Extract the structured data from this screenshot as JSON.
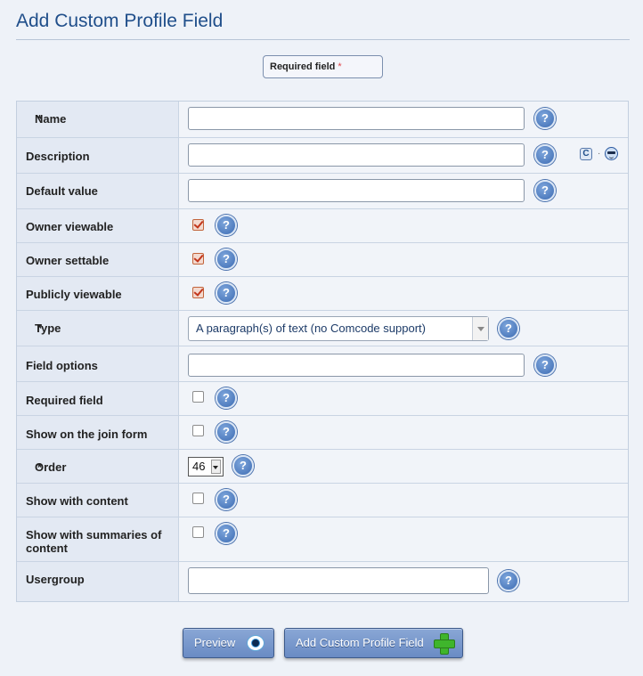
{
  "page": {
    "title": "Add Custom Profile Field"
  },
  "legend": {
    "label": "Required field",
    "star": "*"
  },
  "fields": {
    "name": {
      "label": "Name",
      "star": "*",
      "value": ""
    },
    "description": {
      "label": "Description",
      "value": ""
    },
    "default_value": {
      "label": "Default value",
      "value": ""
    },
    "owner_viewable": {
      "label": "Owner viewable",
      "checked": true
    },
    "owner_settable": {
      "label": "Owner settable",
      "checked": true
    },
    "publicly_viewable": {
      "label": "Publicly viewable",
      "checked": true
    },
    "type": {
      "label": "Type",
      "star": "*",
      "selected": "A paragraph(s) of text (no Comcode support)"
    },
    "field_options": {
      "label": "Field options",
      "value": ""
    },
    "required_field": {
      "label": "Required field",
      "checked": false
    },
    "show_on_join_form": {
      "label": "Show on the join form",
      "checked": false
    },
    "order": {
      "label": "Order",
      "star": "*",
      "selected": "46"
    },
    "show_with_content": {
      "label": "Show with content",
      "checked": false
    },
    "show_with_summaries": {
      "label_line1": "Show with summaries of",
      "label_line2": "content",
      "checked": false
    },
    "usergroup": {
      "label": "Usergroup",
      "value": ""
    }
  },
  "help_glyph": "?",
  "icons": {
    "help": "help-icon",
    "comcode": "comcode-icon",
    "emoticon": "smiley-icon",
    "preview": "eye-icon",
    "add": "plus-icon"
  },
  "comcode_glyph": "C",
  "separator": "·",
  "buttons": {
    "preview": "Preview",
    "submit": "Add Custom Profile Field"
  },
  "colors": {
    "title": "#1f4e8a",
    "required_star": "#e0474c",
    "button": "#6a8bc4"
  }
}
